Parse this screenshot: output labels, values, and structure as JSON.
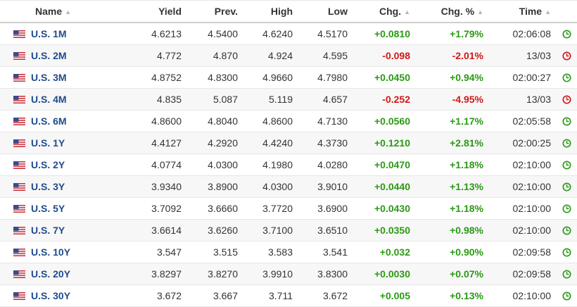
{
  "header": {
    "name": "Name",
    "yield": "Yield",
    "prev": "Prev.",
    "high": "High",
    "low": "Low",
    "chg": "Chg.",
    "chg_pct": "Chg. %",
    "time": "Time"
  },
  "colors": {
    "positive": "#2a9a14",
    "negative": "#d01818",
    "name_link": "#1f4b8e"
  },
  "rows": [
    {
      "name": "U.S. 1M",
      "yield": "4.6213",
      "prev": "4.5400",
      "high": "4.6240",
      "low": "4.5170",
      "chg": "+0.0810",
      "chg_pct": "+1.79%",
      "time": "02:06:08",
      "dir": "pos",
      "status": "open"
    },
    {
      "name": "U.S. 2M",
      "yield": "4.772",
      "prev": "4.870",
      "high": "4.924",
      "low": "4.595",
      "chg": "-0.098",
      "chg_pct": "-2.01%",
      "time": "13/03",
      "dir": "neg",
      "status": "closed"
    },
    {
      "name": "U.S. 3M",
      "yield": "4.8752",
      "prev": "4.8300",
      "high": "4.9660",
      "low": "4.7980",
      "chg": "+0.0450",
      "chg_pct": "+0.94%",
      "time": "02:00:27",
      "dir": "pos",
      "status": "open"
    },
    {
      "name": "U.S. 4M",
      "yield": "4.835",
      "prev": "5.087",
      "high": "5.119",
      "low": "4.657",
      "chg": "-0.252",
      "chg_pct": "-4.95%",
      "time": "13/03",
      "dir": "neg",
      "status": "closed"
    },
    {
      "name": "U.S. 6M",
      "yield": "4.8600",
      "prev": "4.8040",
      "high": "4.8600",
      "low": "4.7130",
      "chg": "+0.0560",
      "chg_pct": "+1.17%",
      "time": "02:05:58",
      "dir": "pos",
      "status": "open"
    },
    {
      "name": "U.S. 1Y",
      "yield": "4.4127",
      "prev": "4.2920",
      "high": "4.4240",
      "low": "4.3730",
      "chg": "+0.1210",
      "chg_pct": "+2.81%",
      "time": "02:00:25",
      "dir": "pos",
      "status": "open"
    },
    {
      "name": "U.S. 2Y",
      "yield": "4.0774",
      "prev": "4.0300",
      "high": "4.1980",
      "low": "4.0280",
      "chg": "+0.0470",
      "chg_pct": "+1.18%",
      "time": "02:10:00",
      "dir": "pos",
      "status": "open"
    },
    {
      "name": "U.S. 3Y",
      "yield": "3.9340",
      "prev": "3.8900",
      "high": "4.0300",
      "low": "3.9010",
      "chg": "+0.0440",
      "chg_pct": "+1.13%",
      "time": "02:10:00",
      "dir": "pos",
      "status": "open"
    },
    {
      "name": "U.S. 5Y",
      "yield": "3.7092",
      "prev": "3.6660",
      "high": "3.7720",
      "low": "3.6900",
      "chg": "+0.0430",
      "chg_pct": "+1.18%",
      "time": "02:10:00",
      "dir": "pos",
      "status": "open"
    },
    {
      "name": "U.S. 7Y",
      "yield": "3.6614",
      "prev": "3.6260",
      "high": "3.7100",
      "low": "3.6510",
      "chg": "+0.0350",
      "chg_pct": "+0.98%",
      "time": "02:10:00",
      "dir": "pos",
      "status": "open"
    },
    {
      "name": "U.S. 10Y",
      "yield": "3.547",
      "prev": "3.515",
      "high": "3.583",
      "low": "3.541",
      "chg": "+0.032",
      "chg_pct": "+0.90%",
      "time": "02:09:58",
      "dir": "pos",
      "status": "open"
    },
    {
      "name": "U.S. 20Y",
      "yield": "3.8297",
      "prev": "3.8270",
      "high": "3.9910",
      "low": "3.8300",
      "chg": "+0.0030",
      "chg_pct": "+0.07%",
      "time": "02:09:58",
      "dir": "pos",
      "status": "open"
    },
    {
      "name": "U.S. 30Y",
      "yield": "3.672",
      "prev": "3.667",
      "high": "3.711",
      "low": "3.672",
      "chg": "+0.005",
      "chg_pct": "+0.13%",
      "time": "02:10:00",
      "dir": "pos",
      "status": "open"
    }
  ]
}
